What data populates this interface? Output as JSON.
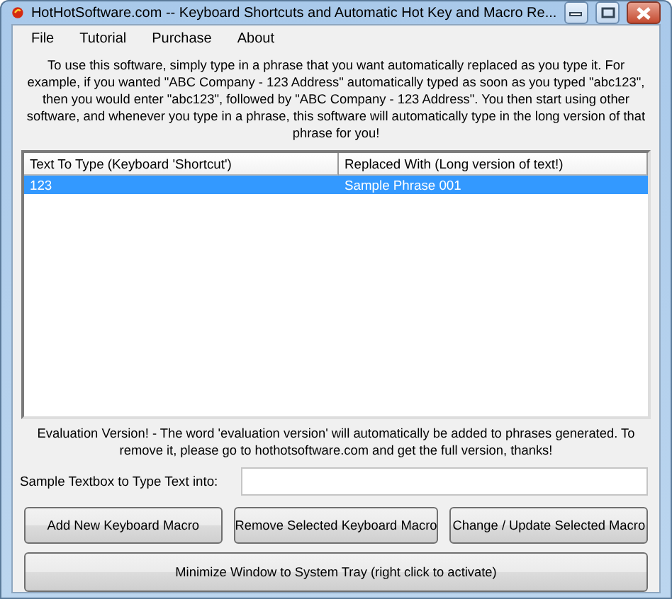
{
  "window": {
    "title": "HotHotSoftware.com -- Keyboard Shortcuts and Automatic Hot Key and Macro Re..."
  },
  "menu": [
    {
      "label": "File"
    },
    {
      "label": "Tutorial"
    },
    {
      "label": "Purchase"
    },
    {
      "label": "About"
    }
  ],
  "intro": "To use this software, simply type in a phrase that you want automatically replaced as you type it. For example, if you wanted \"ABC Company - 123 Address\" automatically typed as soon as you typed \"abc123\", then you would enter \"abc123\", followed by \"ABC Company - 123 Address\". You then start using other software, and whenever you type in a phrase, this software will automatically type in the long version of that phrase for you!",
  "table": {
    "columns": [
      "Text To Type (Keyboard 'Shortcut')",
      "Replaced With (Long version of text!)"
    ],
    "rows": [
      {
        "cells": [
          "123",
          "Sample Phrase 001"
        ],
        "selected": true
      }
    ]
  },
  "notice": "Evaluation Version! - The word 'evaluation version' will automatically be added to phrases generated. To remove it, please go to hothotsoftware.com and get the full version, thanks!",
  "sample_field": {
    "label": "Sample Textbox to Type Text into:"
  },
  "buttons": [
    "Add New Keyboard  Macro",
    "Remove Selected Keyboard Macro",
    "Change / Update Selected Macro"
  ],
  "tray_button": "Minimize Window to System Tray (right click to activate)"
}
